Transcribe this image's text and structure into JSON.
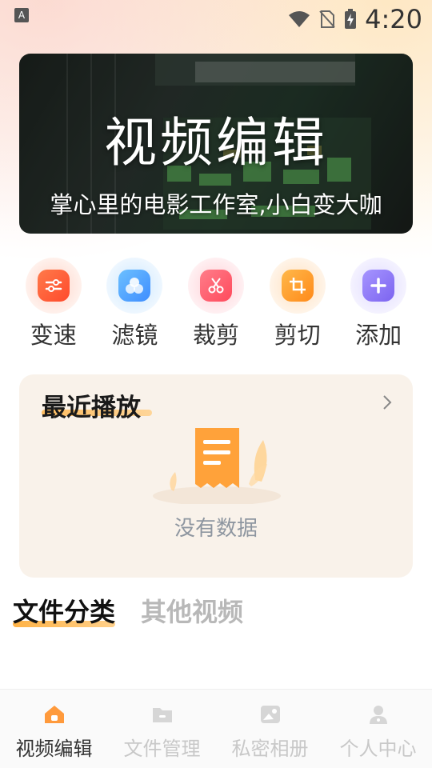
{
  "status_bar": {
    "app_indicator": "A",
    "time": "4:20",
    "icons": [
      "wifi-icon",
      "no-sim-icon",
      "battery-charging-icon"
    ]
  },
  "banner": {
    "title": "视频编辑",
    "subtitle": "掌心里的电影工作室,小白变大咖"
  },
  "tools": [
    {
      "label": "变速",
      "icon": "sliders-icon",
      "color": "#ff5a3c",
      "halo": "#ffe3dc"
    },
    {
      "label": "滤镜",
      "icon": "filter-icon",
      "color": "#4aa8ff",
      "halo": "#dcefff"
    },
    {
      "label": "裁剪",
      "icon": "scissors-icon",
      "color": "#ff5a6a",
      "halo": "#ffe0e3"
    },
    {
      "label": "剪切",
      "icon": "crop-icon",
      "color": "#ff9a1f",
      "halo": "#ffecd6"
    },
    {
      "label": "添加",
      "icon": "plus-icon",
      "color": "#8f7cf2",
      "halo": "#ebe6ff"
    }
  ],
  "recent": {
    "title": "最近播放",
    "empty_text": "没有数据"
  },
  "categories": {
    "active": "文件分类",
    "inactive": "其他视频"
  },
  "bottom_nav": [
    {
      "label": "视频编辑",
      "icon": "home-icon",
      "active": true
    },
    {
      "label": "文件管理",
      "icon": "folder-icon",
      "active": false
    },
    {
      "label": "私密相册",
      "icon": "photo-album-icon",
      "active": false
    },
    {
      "label": "个人中心",
      "icon": "user-icon",
      "active": false
    }
  ],
  "colors": {
    "accent": "#ff9a1f",
    "inactive_nav": "#c8c8c8",
    "card_bg": "#f9f2ea"
  }
}
